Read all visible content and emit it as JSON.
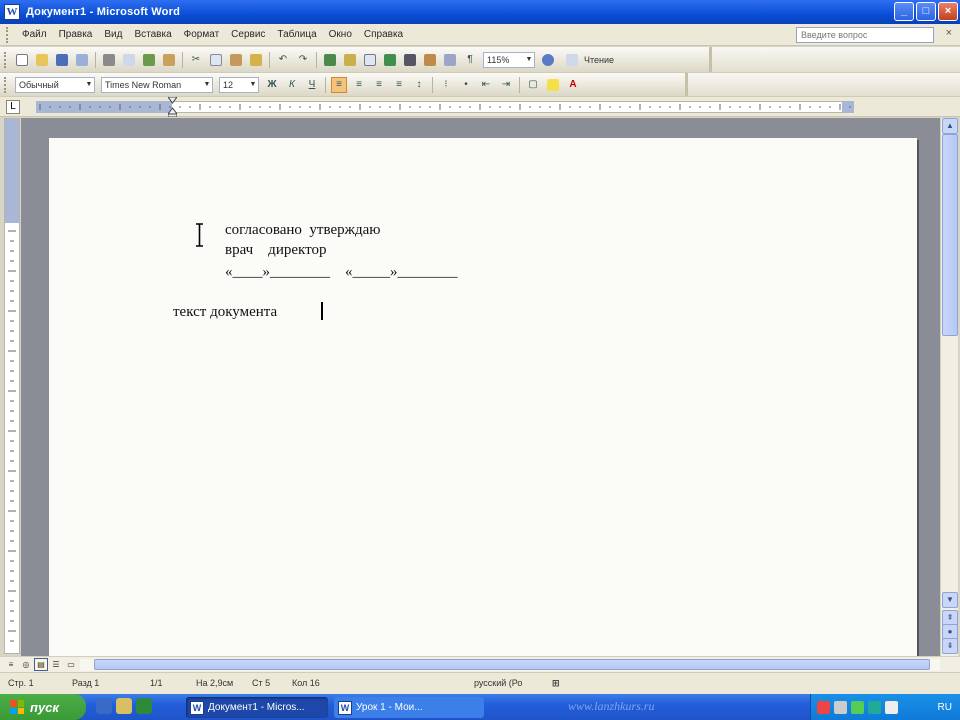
{
  "window": {
    "title": "Документ1 - Microsoft Word",
    "app_icon": "W"
  },
  "menu": {
    "items": [
      "Файл",
      "Правка",
      "Вид",
      "Вставка",
      "Формат",
      "Сервис",
      "Таблица",
      "Окно",
      "Справка"
    ],
    "help_placeholder": "Введите вопрос"
  },
  "toolbar_standard": {
    "zoom": "115%",
    "read_label": "Чтение"
  },
  "toolbar_format": {
    "style": "Обычный",
    "font": "Times New Roman",
    "size": "12"
  },
  "document": {
    "lines": [
      "согласовано  утверждаю",
      "врач    директор",
      "«____»________    «_____»________",
      "текст документа"
    ]
  },
  "status": {
    "page": "Стр. 1",
    "section": "Разд 1",
    "pages": "1/1",
    "position": "На 2,9см",
    "line": "Ст 5",
    "column": "Кол 16",
    "language": "русский (Ро"
  },
  "watermark": "www.lanzhkurs.ru",
  "taskbar": {
    "start_label": "пуск",
    "tasks": [
      "Документ1 - Micros...",
      "Урок 1 - Мои..."
    ],
    "clock": "RU"
  },
  "colors": {
    "titlebar": "#0a4fd6",
    "taskbar": "#245edb",
    "start": "#3a9a35",
    "page": "#fbfbf8",
    "workspace": "#8a8d95"
  }
}
